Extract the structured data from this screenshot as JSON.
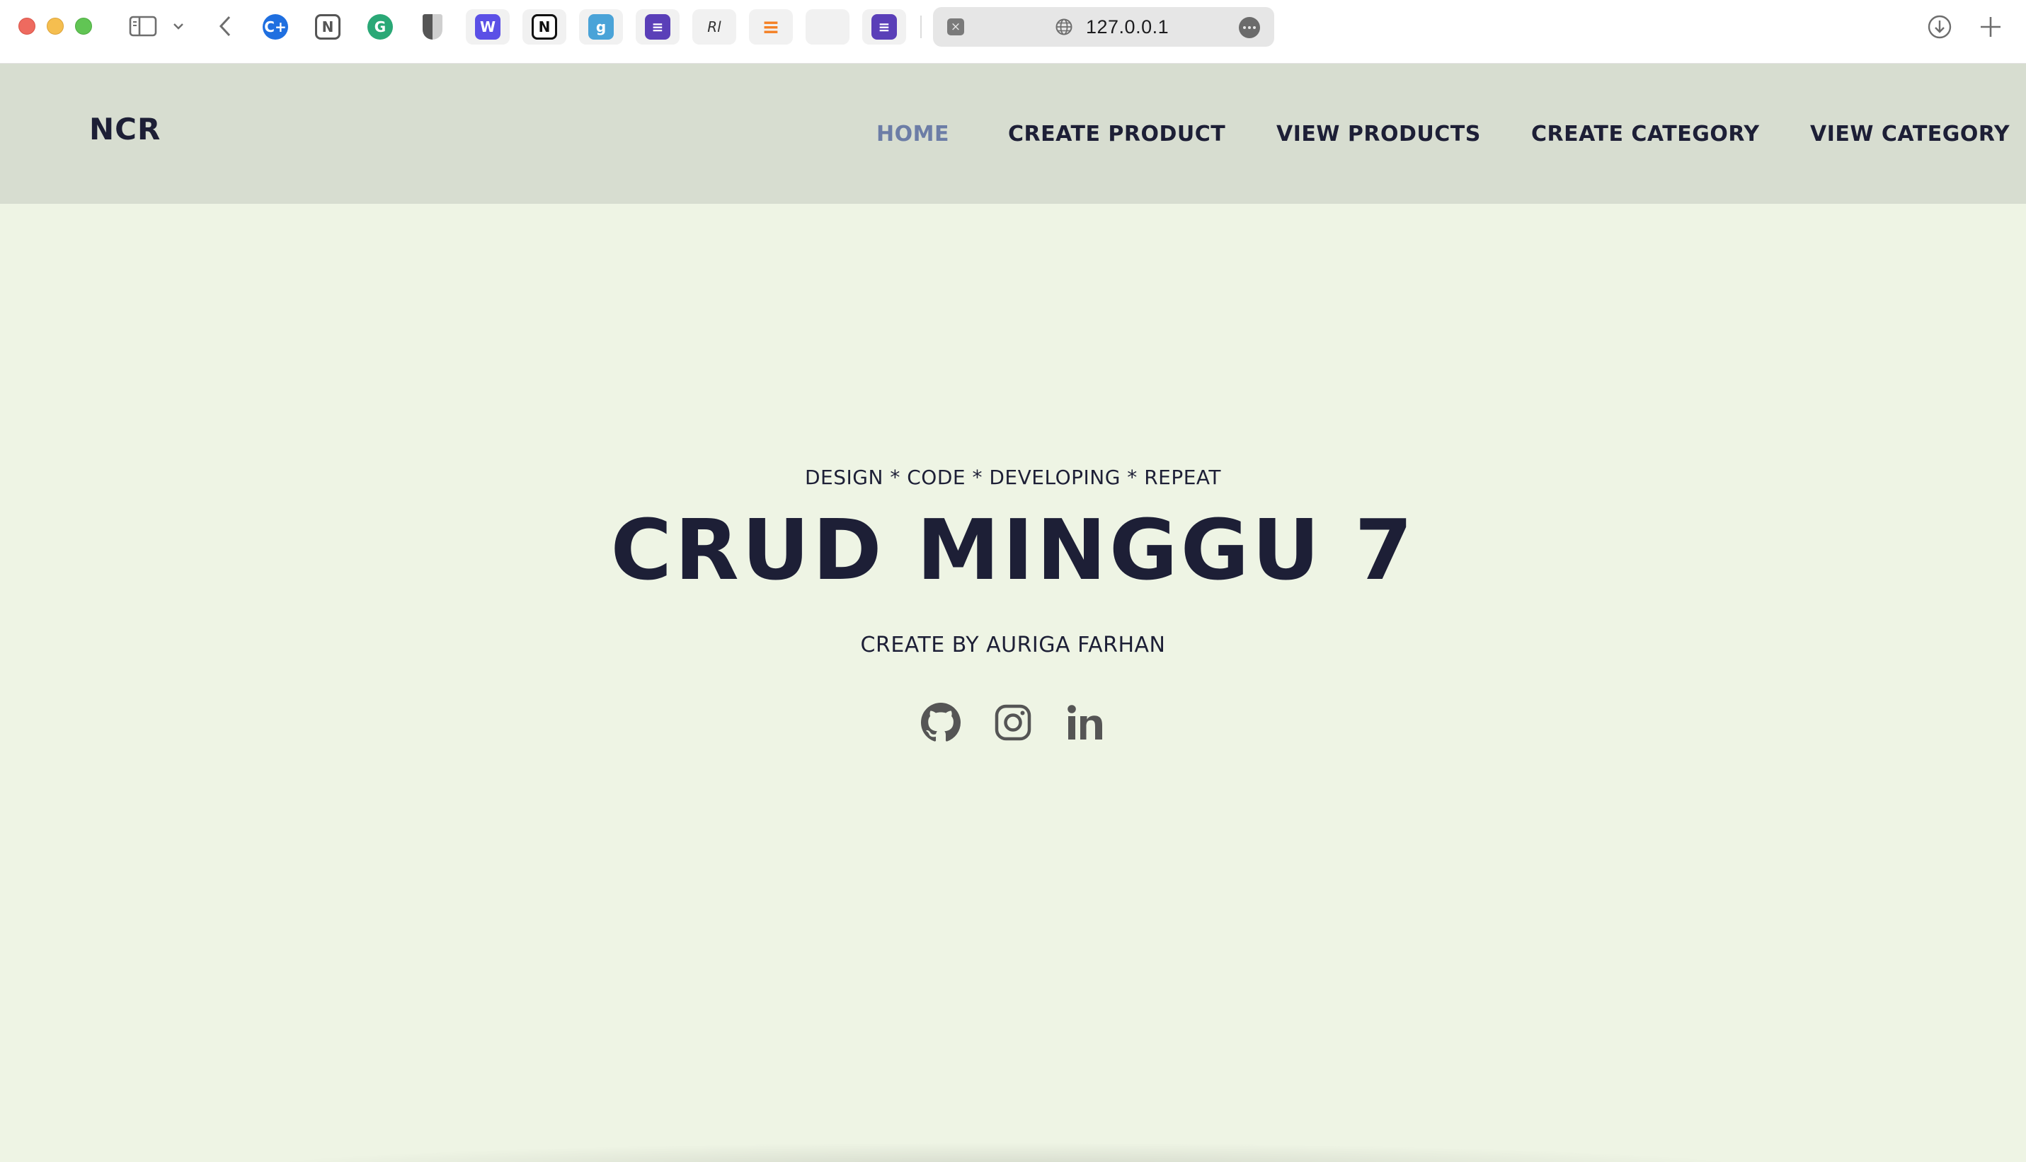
{
  "browser": {
    "url": "127.0.0.1",
    "extensions": [
      {
        "name": "copilot-extension-icon",
        "glyph": "C+",
        "color": "#1f6fe0"
      },
      {
        "name": "notion-extension-icon",
        "glyph": "N",
        "color": "#555555"
      },
      {
        "name": "grammarly-extension-icon",
        "glyph": "G",
        "color": "#2aa876"
      },
      {
        "name": "privacy-shield-extension-icon",
        "glyph": "",
        "color": "#555555"
      },
      {
        "name": "word-tool-extension-icon",
        "glyph": "W",
        "color": "#5b50e6"
      },
      {
        "name": "notion-web-clipper-extension-icon",
        "glyph": "N",
        "color": "#111111"
      },
      {
        "name": "goodnotes-extension-icon",
        "glyph": "g",
        "color": "#4aa3d8"
      },
      {
        "name": "list-app-extension-icon",
        "glyph": "≡",
        "color": "#5a3fb8"
      },
      {
        "name": "signature-extension-icon",
        "glyph": "Rl",
        "color": "#333333"
      },
      {
        "name": "stackoverflow-extension-icon",
        "glyph": "≡",
        "color": "#f48024"
      },
      {
        "name": "wheat-extension-icon",
        "glyph": "",
        "color": "#6b2c6e"
      },
      {
        "name": "list-app-2-extension-icon",
        "glyph": "≡",
        "color": "#5a3fb8"
      }
    ]
  },
  "navbar": {
    "brand": "NCR",
    "links": [
      {
        "label": "HOME",
        "active": true
      },
      {
        "label": "CREATE PRODUCT",
        "active": false
      },
      {
        "label": "VIEW PRODUCTS",
        "active": false
      },
      {
        "label": "CREATE CATEGORY",
        "active": false
      },
      {
        "label": "VIEW CATEGORY",
        "active": false
      }
    ]
  },
  "hero": {
    "tagline": "DESIGN * CODE * DEVELOPING * REPEAT",
    "title": "CRUD MINGGU 7",
    "credit": "CREATE BY AURIGA FARHAN",
    "socials": [
      "github-icon",
      "instagram-icon",
      "linkedin-icon"
    ]
  },
  "colors": {
    "navbar_bg": "#d7ddd0",
    "page_bg": "#eef4e4",
    "text_dark": "#1d1f36",
    "nav_active": "#6c7da6",
    "social_icon": "#555555"
  }
}
